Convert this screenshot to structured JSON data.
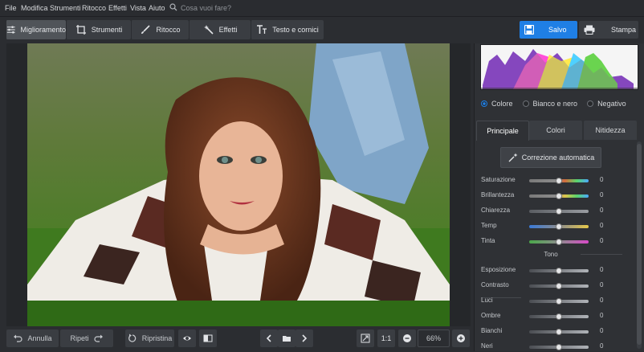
{
  "menu": [
    "File",
    "Modifica",
    "Strumenti",
    "Ritocco",
    "Effetti",
    "Vista",
    "Aiuto"
  ],
  "search": {
    "placeholder": "Cosa vuoi fare?"
  },
  "tabs": [
    {
      "label": "Miglioramento",
      "icon": "sliders-icon",
      "active": true
    },
    {
      "label": "Strumenti",
      "icon": "crop-icon"
    },
    {
      "label": "Ritocco",
      "icon": "brush-icon"
    },
    {
      "label": "Effetti",
      "icon": "magic-wand-icon"
    },
    {
      "label": "Testo e cornici",
      "icon": "text-icon"
    }
  ],
  "actions": {
    "save": "Salvo",
    "print": "Stampa"
  },
  "bottom": {
    "undo": "Annulla",
    "redo": "Ripeti",
    "reset": "Ripristina",
    "one_to_one": "1:1",
    "zoom": "66%"
  },
  "color_modes": [
    {
      "label": "Colore",
      "selected": true
    },
    {
      "label": "Bianco e nero",
      "selected": false
    },
    {
      "label": "Negativo",
      "selected": false
    }
  ],
  "panel_tabs": [
    {
      "label": "Principale",
      "active": true
    },
    {
      "label": "Colori"
    },
    {
      "label": "Nitidezza"
    }
  ],
  "auto_correct": "Correzione automatica",
  "sliders_top": [
    {
      "label": "Saturazione",
      "value": "0",
      "track": "sat"
    },
    {
      "label": "Brillantezza",
      "value": "0",
      "track": "bril"
    },
    {
      "label": "Chiarezza",
      "value": "0",
      "track": "gray"
    },
    {
      "label": "Temp",
      "value": "0",
      "track": "temp"
    },
    {
      "label": "Tinta",
      "value": "0",
      "track": "tint"
    }
  ],
  "tone_title": "Tono",
  "sliders_tone": [
    {
      "label": "Esposizione",
      "value": "0"
    },
    {
      "label": "Contrasto",
      "value": "0"
    },
    {
      "label": "Luci",
      "value": "0"
    },
    {
      "label": "Ombre",
      "value": "0"
    },
    {
      "label": "Bianchi",
      "value": "0"
    },
    {
      "label": "Neri",
      "value": "0"
    }
  ],
  "colors": {
    "accent": "#1f7fe5",
    "panel": "#2f3135",
    "background": "#2b2d31"
  }
}
